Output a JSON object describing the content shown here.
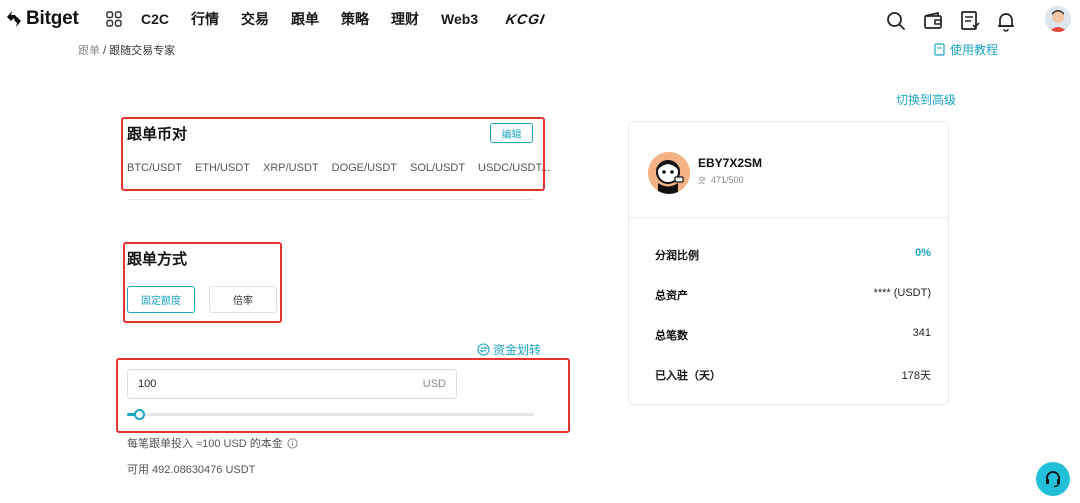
{
  "header": {
    "logo_text": "Bitget",
    "nav": [
      "C2C",
      "行情",
      "交易",
      "跟单",
      "策略",
      "理财",
      "Web3"
    ],
    "kcgi_text": "KCGI"
  },
  "breadcrumb": {
    "root": "跟单",
    "separator": " / ",
    "current": "跟随交易专家"
  },
  "tutorial_label": "使用教程",
  "switch_advanced_label": "切换到高级",
  "pairs_section": {
    "title": "跟单币对",
    "edit_label": "编辑",
    "pairs": [
      "BTC/USDT",
      "ETH/USDT",
      "XRP/USDT",
      "DOGE/USDT",
      "SOL/USDT",
      "USDC/USDT..."
    ]
  },
  "mode_section": {
    "title": "跟单方式",
    "options": [
      "固定额度",
      "倍率"
    ],
    "selected": "固定额度"
  },
  "amount_section": {
    "transfer_label": "资金划转",
    "value": "100",
    "unit": "USD",
    "slider_percent": 3,
    "per_order_text": "每笔跟单投入 ≈100 USD 的本金",
    "available_text": "可用 492.08630476 USDT"
  },
  "trader": {
    "name": "EBY7X2SM",
    "followers": "471/500",
    "stats": [
      {
        "label": "分润比例",
        "value": "0%"
      },
      {
        "label": "总资产",
        "value": "**** (USDT)"
      },
      {
        "label": "总笔数",
        "value": "341"
      },
      {
        "label": "已入驻（天）",
        "value": "178天"
      }
    ]
  },
  "colors": {
    "accent": "#1aa6c5",
    "highlight_box": "#e5332e"
  }
}
